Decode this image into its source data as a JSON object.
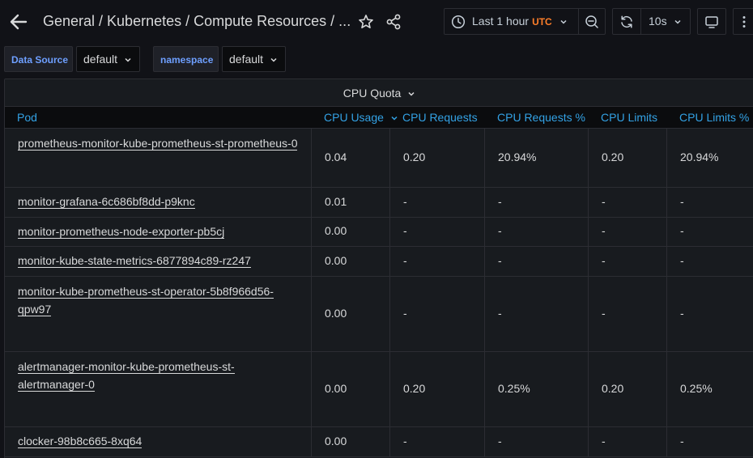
{
  "breadcrumb": "General  / Kubernetes / Compute Resources / ...",
  "time_range": {
    "label": "Last 1 hour",
    "tz": "UTC"
  },
  "refresh": {
    "interval": "10s"
  },
  "variables": [
    {
      "label": "Data Source",
      "value": "default"
    },
    {
      "label": "namespace",
      "value": "default"
    }
  ],
  "panel": {
    "title": "CPU Quota",
    "columns": [
      "Pod",
      "CPU Usage",
      "CPU Requests",
      "CPU Requests %",
      "CPU Limits",
      "CPU Limits %"
    ],
    "rows": [
      {
        "pod": "prometheus-monitor-kube-prometheus-st-prometheus-0",
        "usage": "0.04",
        "requests": "0.20",
        "requests_pct": "20.94%",
        "limits": "0.20",
        "limits_pct": "20.94%"
      },
      {
        "pod": "monitor-grafana-6c686bf8dd-p9knc",
        "usage": "0.01",
        "requests": "-",
        "requests_pct": "-",
        "limits": "-",
        "limits_pct": "-"
      },
      {
        "pod": "monitor-prometheus-node-exporter-pb5cj",
        "usage": "0.00",
        "requests": "-",
        "requests_pct": "-",
        "limits": "-",
        "limits_pct": "-"
      },
      {
        "pod": "monitor-kube-state-metrics-6877894c89-rz247",
        "usage": "0.00",
        "requests": "-",
        "requests_pct": "-",
        "limits": "-",
        "limits_pct": "-"
      },
      {
        "pod_lines": [
          "monitor-kube-prometheus-st-operator-5b8f966d56-",
          "qpw97"
        ],
        "usage": "0.00",
        "requests": "-",
        "requests_pct": "-",
        "limits": "-",
        "limits_pct": "-"
      },
      {
        "pod_lines": [
          "alertmanager-monitor-kube-prometheus-st-",
          "alertmanager-0"
        ],
        "usage": "0.00",
        "requests": "0.20",
        "requests_pct": "0.25%",
        "limits": "0.20",
        "limits_pct": "0.25%"
      },
      {
        "pod": "clocker-98b8c665-8xq64",
        "usage": "0.00",
        "requests": "-",
        "requests_pct": "-",
        "limits": "-",
        "limits_pct": "-"
      }
    ]
  },
  "colors": {
    "background": "#111217",
    "panel": "#181b1f",
    "header_link": "#33a2e5",
    "variable_label": "#6e9fff",
    "utc": "#ff7f2a"
  },
  "icons": [
    "arrow-left-icon",
    "star-icon",
    "share-icon",
    "clock-icon",
    "chevron-down-icon",
    "zoom-out-icon",
    "refresh-icon",
    "tv-icon",
    "more-vertical-icon"
  ]
}
